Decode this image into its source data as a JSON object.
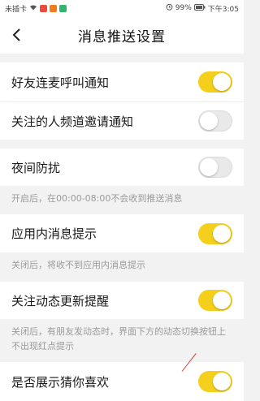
{
  "status_bar": {
    "carrier": "未插卡",
    "battery": "99%",
    "time": "下午3:05",
    "icons": [
      "wifi-icon",
      "app-badge-icon",
      "app-badge-icon",
      "app-badge-icon",
      "alarm-icon",
      "battery-icon"
    ]
  },
  "header": {
    "title": "消息推送设置",
    "back_icon": "chevron-left-icon"
  },
  "settings": [
    {
      "label": "好友连麦呼叫通知",
      "enabled": true
    },
    {
      "label": "关注的人频道邀请通知",
      "enabled": false
    },
    {
      "label": "夜间防扰",
      "enabled": false,
      "hint": "开启后，在00:00-08:00不会收到推送消息"
    },
    {
      "label": "应用内消息提示",
      "enabled": true,
      "hint": "关闭后，将收不到应用内消息提示"
    },
    {
      "label": "关注动态更新提醒",
      "enabled": true,
      "hint": "关闭后，有朋友发动态时，界面下方的动态切换按钮上不出现红点提示"
    },
    {
      "label": "是否展示猜你喜欢",
      "enabled": true
    }
  ],
  "colors": {
    "toggle_on": "#f4cf1b",
    "toggle_off": "#e9e9e9",
    "background": "#f2f2f2"
  }
}
